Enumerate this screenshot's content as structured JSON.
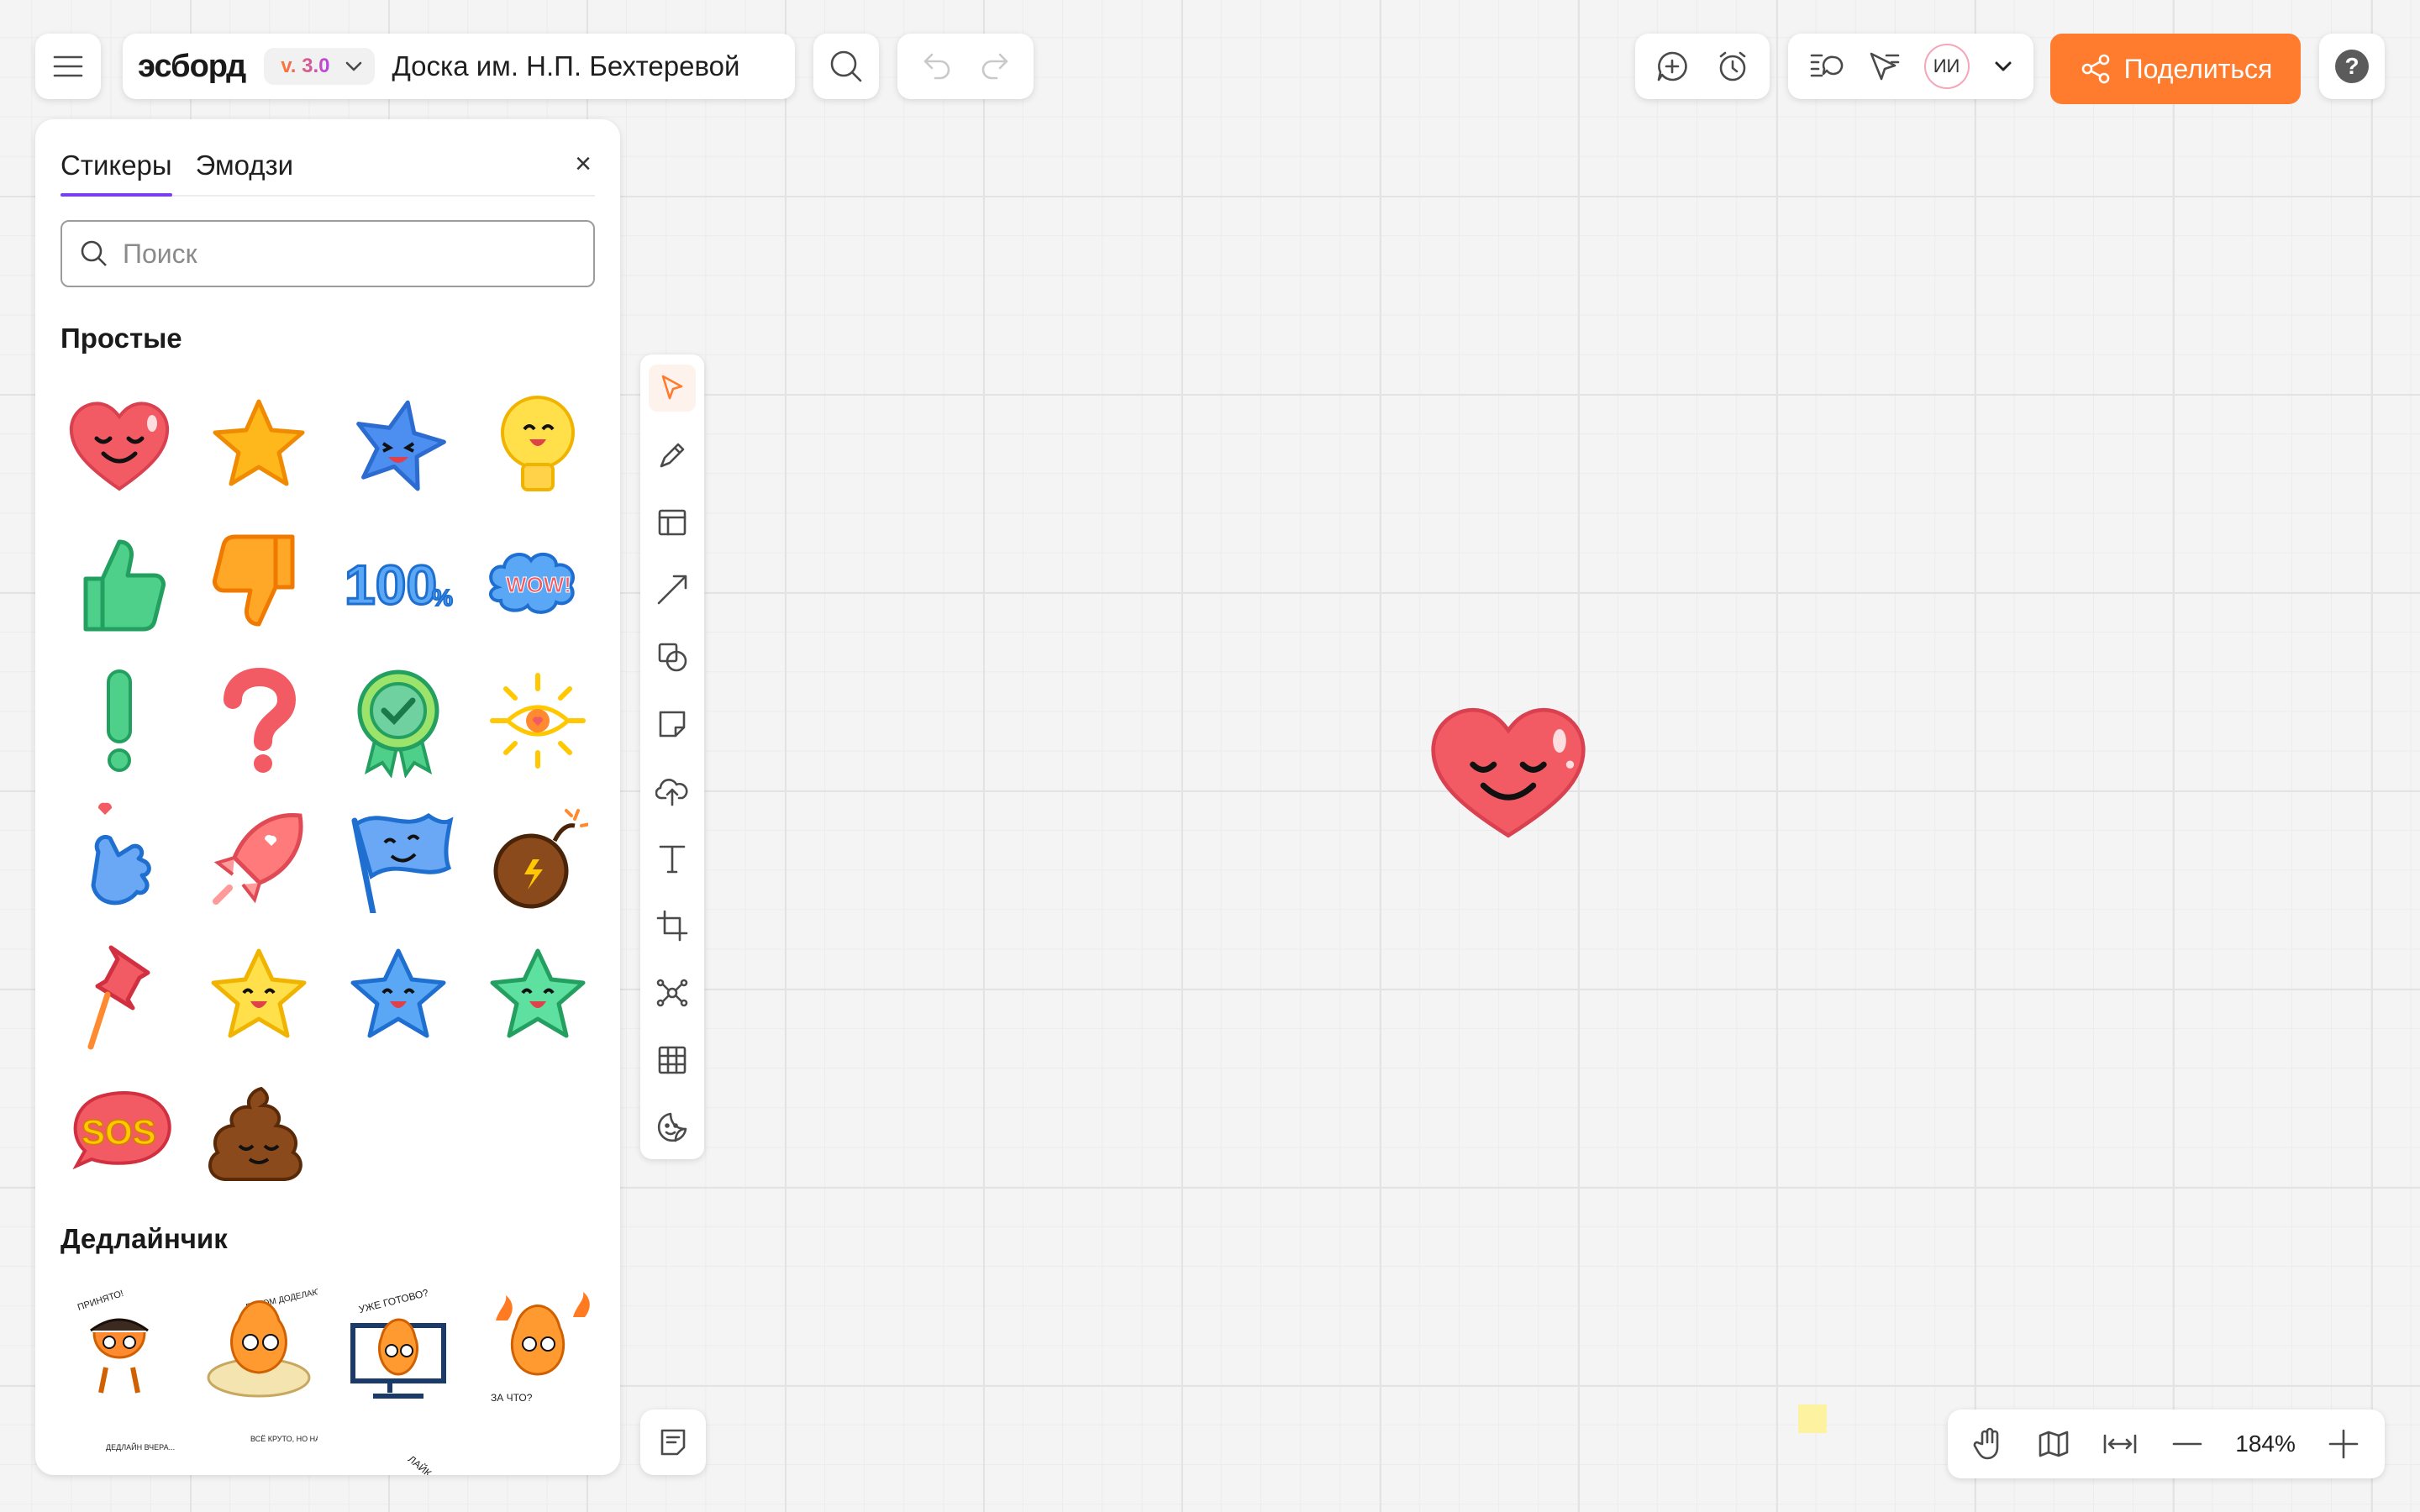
{
  "header": {
    "logo": "эсборд",
    "version": "v. 3.0",
    "board_name": "Доска им. Н.П. Бехтеревой",
    "ai_label": "ИИ",
    "share_label": "Поделиться",
    "help_label": "?"
  },
  "panel": {
    "tabs": [
      {
        "label": "Стикеры",
        "active": true
      },
      {
        "label": "Эмодзи",
        "active": false
      }
    ],
    "close_label": "×",
    "search_placeholder": "Поиск",
    "sections": [
      {
        "title": "Простые",
        "count": 22
      },
      {
        "title": "Дедлайнчик"
      }
    ],
    "deadline_captions": [
      "ПРИНЯТО!",
      "ПОТОМ ДОДЕЛАЮ",
      "УЖЕ ГОТОВО?",
      "ЗА ЧТО?",
      "ДЕДЛАЙН ВЧЕРА...",
      "ВСЁ КРУТО, НО НАДО ПЕРЕДЕЛАТЬ",
      "ЛАЙК"
    ]
  },
  "toolbar": {
    "tools": [
      "select-icon",
      "pen-icon",
      "template-icon",
      "arrow-line-icon",
      "shapes-icon",
      "sticky-note-icon",
      "upload-icon",
      "text-icon",
      "frame-icon",
      "mindmap-icon",
      "table-icon",
      "sticker-icon"
    ],
    "active": "select-icon"
  },
  "zoom": {
    "value": "184%"
  },
  "colors": {
    "accent": "#ff7b2e",
    "tab_active": "#7a3df0",
    "heart": "#f25b63"
  }
}
